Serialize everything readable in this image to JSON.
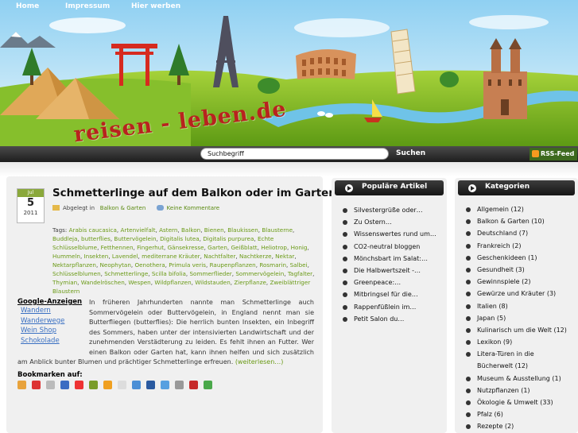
{
  "site": {
    "logo_text": "reisen - leben.de"
  },
  "nav": {
    "items": [
      "Home",
      "Impressum",
      "Hier werben"
    ],
    "search_placeholder": "Suchbegriff",
    "search_button": "Suchen",
    "rss": "RSS-Feed"
  },
  "post": {
    "date": {
      "month": "Jul",
      "day": "5",
      "year": "2011"
    },
    "title": "Schmetterlinge auf dem Balkon oder im Garten füttern",
    "category_label": "Abgelegt in",
    "category": "Balkon & Garten",
    "comments": "Keine Kommentare",
    "tags_label": "Tags:",
    "tags": [
      "Arabis caucasica",
      "Artenvielfalt",
      "Astern",
      "Balkon",
      "Bienen",
      "Blaukissen",
      "Blausterne",
      "Buddleja",
      "butterflies",
      "Buttervögelein",
      "Digitalis lutea",
      "Digitalis purpurea",
      "Echte Schlüsselblume",
      "Fetthennen",
      "Fingerhut",
      "Gänsekresse",
      "Garten",
      "Geißblatt",
      "Heliotrop",
      "Honig",
      "Hummeln",
      "Insekten",
      "Lavendel",
      "mediterrane Kräuter",
      "Nachtfalter",
      "Nachtkerze",
      "Nektar",
      "Nektarpflanzen",
      "Neophytan",
      "Oenothera",
      "Primula veris",
      "Raupenpflanzen",
      "Rosmarin",
      "Salbei",
      "Schlüsselblumen",
      "Schmetterlinge",
      "Scilla bifolia",
      "Sommerflieder",
      "Sommervögelein",
      "Tagfalter",
      "Thymian",
      "Wandelröschen",
      "Wespen",
      "Wildpflanzen",
      "Wildstauden",
      "Zierpflanze",
      "Zweiblättriger Blaustern"
    ],
    "excerpt": "In früheren Jahrhunderten nannte man Schmetterlinge auch Sommervögelein oder Buttervögelein, in England nennt man sie Butterfliegen (butterflies): Die herrlich bunten Insekten, ein Inbegriff des Sommers, haben unter der intensivierten Landwirtschaft und der zunehmenden Verstädterung zu leiden. Es fehlt ihnen an Futter. Wer einen Balkon oder Garten hat, kann ihnen helfen und sich zusätzlich am Anblick bunter Blumen und prächtiger Schmetterlinge erfreuen.",
    "read_more": "(weiterlesen…)",
    "bookmarks_title": "Bookmarken auf:"
  },
  "ads": {
    "title": "Google-Anzeigen",
    "links": [
      "Wandern",
      "Wanderwege",
      "Wein Shop",
      "Schokolade"
    ]
  },
  "popular": {
    "title": "Populäre Artikel",
    "items": [
      "Silvestergrüße oder…",
      "Zu Ostern…",
      "Wissenswertes rund um…",
      "CO2-neutral bloggen",
      "Mönchsbart im Salat:…",
      "Die Halbwertszeit -…",
      "Greenpeace:…",
      "Mitbringsel für die…",
      "Rappenfüßlein im…",
      "Petit Salon du…"
    ]
  },
  "categories": {
    "title": "Kategorien",
    "items": [
      "Allgemein (12)",
      "Balkon & Garten (10)",
      "Deutschland (7)",
      "Frankreich (2)",
      "Geschenkideen (1)",
      "Gesundheit (3)",
      "Gewinnspiele (2)",
      "Gewürze und Kräuter (3)",
      "Italien (8)",
      "Japan (5)",
      "Kulinarisch um die Welt (12)",
      "Lexikon (9)",
      "Litera-Türen in die",
      "Bücherwelt (12)",
      "Museum & Ausstellung (1)",
      "Nutzpflanzen (1)",
      "Ökologie & Umwelt (33)",
      "Pfalz (6)",
      "Rezepte (2)"
    ]
  },
  "colors": {
    "accent_green": "#6a9a16",
    "link_blue": "#3a70c2",
    "logo_red": "#b8231e"
  }
}
